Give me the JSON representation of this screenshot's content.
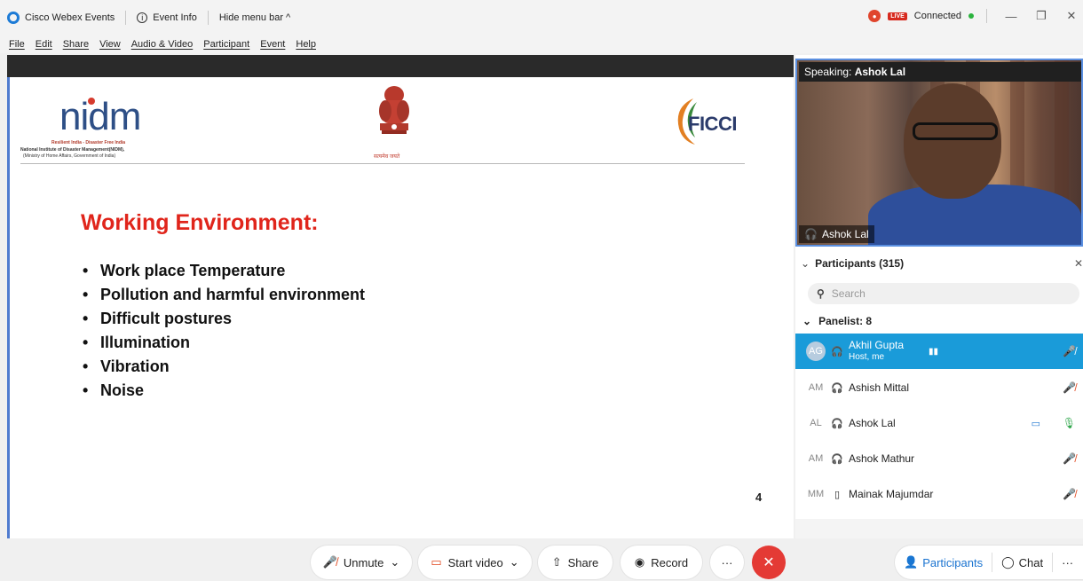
{
  "titlebar": {
    "app_name": "Cisco Webex Events",
    "event_info": "Event Info",
    "hide_menu": "Hide menu bar ^",
    "live": "LIVE",
    "connected": "Connected",
    "minimize": "—",
    "restore": "❐",
    "close": "✕"
  },
  "menu": {
    "items": [
      "File",
      "Edit",
      "Share",
      "View",
      "Audio & Video",
      "Participant",
      "Event",
      "Help"
    ]
  },
  "slide": {
    "nidm_logo": "nidm",
    "nidm_tagline": "Resilient India - Disaster Free India",
    "nidm_line1": "National Institute of Disaster Management(NIDM),",
    "nidm_line2": "(Ministry of Home Affairs, Government of India)",
    "emblem_caption": "सत्यमेव जयते",
    "ficci": "FICCI",
    "title": "Working Environment:",
    "bullets": [
      "Work place Temperature",
      "Pollution and harmful environment",
      "Difficult postures",
      "Illumination",
      "Vibration",
      "Noise"
    ],
    "page_number": "4"
  },
  "video": {
    "speaking_label": "Speaking:",
    "speaking_name": "Ashok Lal",
    "name_tag": "Ashok Lal"
  },
  "participants": {
    "header": "Participants (315)",
    "search_placeholder": "Search",
    "panelist_header": "Panelist: 8",
    "rows": [
      {
        "initials": "AG",
        "name": "Akhil Gupta",
        "role": "Host, me"
      },
      {
        "initials": "AM",
        "name": "Ashish Mittal"
      },
      {
        "initials": "AL",
        "name": "Ashok Lal"
      },
      {
        "initials": "AM",
        "name": "Ashok Mathur"
      },
      {
        "initials": "MM",
        "name": "Mainak Majumdar"
      }
    ]
  },
  "toolbar": {
    "unmute": "Unmute",
    "start_video": "Start video",
    "share": "Share",
    "record": "Record",
    "more": "···",
    "participants": "Participants",
    "chat": "Chat",
    "more_right": "···"
  }
}
